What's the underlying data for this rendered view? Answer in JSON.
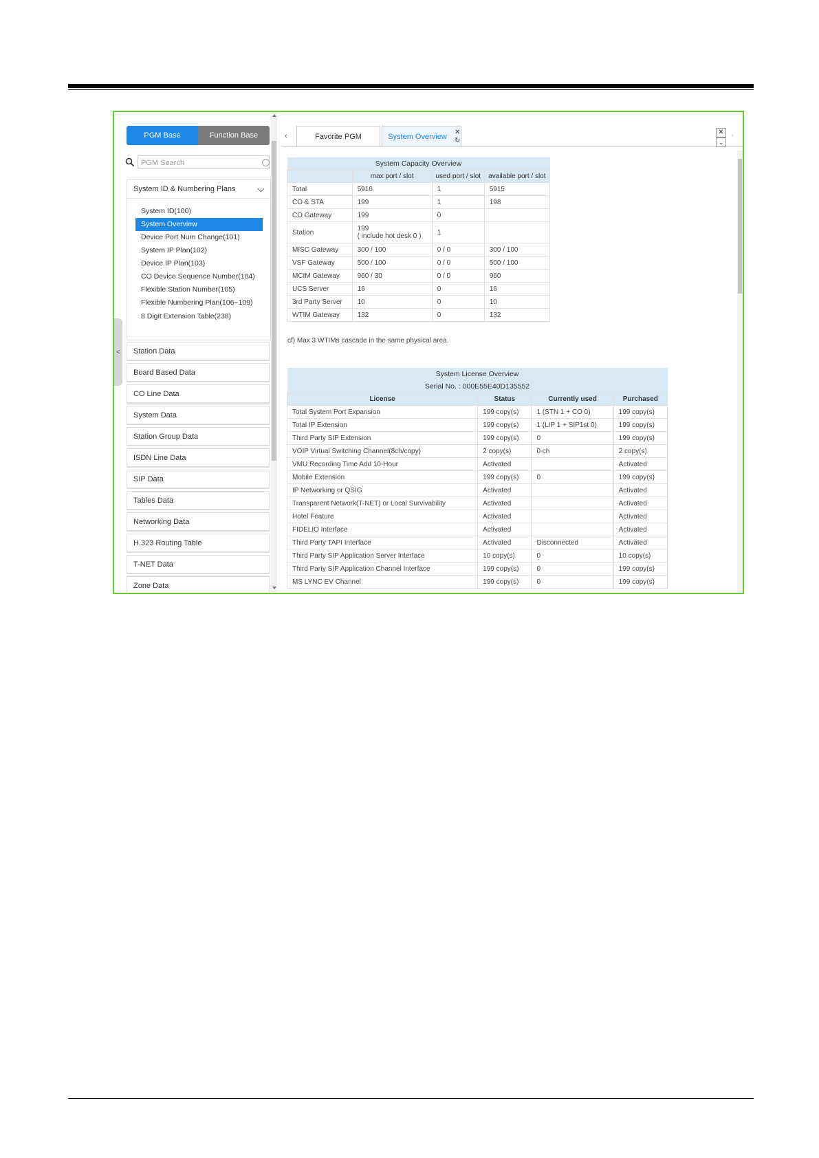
{
  "left": {
    "tabs": [
      "PGM Base",
      "Function Base"
    ],
    "search_placeholder": "PGM Search",
    "group_title": "System ID & Numbering Plans",
    "sub_items": [
      "System ID(100)",
      "System Overview",
      "Device Port Num Change(101)",
      "System IP Plan(102)",
      "Device IP Plan(103)",
      "CO Device Sequence Number(104)",
      "Flexible Station Number(105)",
      "Flexible Numbering Plan(106~109)",
      "8 Digit Extension Table(238)"
    ],
    "selected_item": "System Overview",
    "categories": [
      "Station Data",
      "Board Based Data",
      "CO Line Data",
      "System Data",
      "Station Group Data",
      "ISDN Line Data",
      "SIP Data",
      "Tables Data",
      "Networking Data",
      "H.323 Routing Table",
      "T-NET Data",
      "Zone Data"
    ],
    "collapse_glyph": "<"
  },
  "right": {
    "tabs": [
      "Favorite PGM",
      "System Overview"
    ],
    "active_tab": "System Overview"
  },
  "capacity": {
    "title": "System Capacity Overview",
    "headers": [
      "",
      "max port / slot",
      "used port / slot",
      "available port / slot"
    ],
    "rows": [
      [
        "Total",
        "5916",
        "1",
        "5915"
      ],
      [
        "CO & STA",
        "199",
        "1",
        "198"
      ],
      [
        "CO Gateway",
        "199",
        "0",
        ""
      ],
      [
        "Station",
        "199",
        "1",
        ""
      ],
      [
        "MISC Gateway",
        "300 / 100",
        "0 / 0",
        "300 / 100"
      ],
      [
        "VSF Gateway",
        "500 / 100",
        "0 / 0",
        "500 / 100"
      ],
      [
        "MCIM Gateway",
        "960 / 30",
        "0 / 0",
        "960"
      ],
      [
        "UCS Server",
        "16",
        "0",
        "16"
      ],
      [
        "3rd Party Server",
        "10",
        "0",
        "10"
      ],
      [
        "WTIM Gateway",
        "132",
        "0",
        "132"
      ]
    ],
    "station_note": "( include hot desk 0 )",
    "footnote": "cf) Max 3 WTIMs cascade in the same physical area."
  },
  "license": {
    "title": "System License Overview",
    "serial": "Serial No. : 000E55E40D135552",
    "headers": [
      "License",
      "Status",
      "Currently used",
      "Purchased"
    ],
    "rows": [
      [
        "Total System Port Expansion",
        "199 copy(s)",
        "1 (STN 1 + CO 0)",
        "199 copy(s)"
      ],
      [
        "Total IP Extension",
        "199 copy(s)",
        "1 (LIP 1 + SIP1st 0)",
        "199 copy(s)"
      ],
      [
        "Third Party SIP Extension",
        "199 copy(s)",
        "0",
        "199 copy(s)"
      ],
      [
        "VOIP Virtual Switching Channel(8ch/copy)",
        "2 copy(s)",
        "0 ch",
        "2 copy(s)"
      ],
      [
        "VMU Recording Time Add 10-Hour",
        "Activated",
        "",
        "Activated"
      ],
      [
        "Mobile Extension",
        "199 copy(s)",
        "0",
        "199 copy(s)"
      ],
      [
        "IP Networking or QSIG",
        "Activated",
        "",
        "Activated"
      ],
      [
        "Transparent Network(T-NET) or Local Survivability",
        "Activated",
        "",
        "Activated"
      ],
      [
        "Hotel Feature",
        "Activated",
        "",
        "Activated"
      ],
      [
        "FIDELIO Interface",
        "Activated",
        "",
        "Activated"
      ],
      [
        "Third Party TAPI Interface",
        "Activated",
        "Disconnected",
        "Activated"
      ],
      [
        "Third Party SIP Application Server Interface",
        "10 copy(s)",
        "0",
        "10 copy(s)"
      ],
      [
        "Third Party SIP Application Channel Interface",
        "199 copy(s)",
        "0",
        "199 copy(s)"
      ],
      [
        "MS LYNC EV Channel",
        "199 copy(s)",
        "0",
        "199 copy(s)"
      ]
    ]
  },
  "colors": {
    "accent": "#1e88e5",
    "header_bg": "#d8e9f6",
    "frame_border": "#66cc33"
  }
}
